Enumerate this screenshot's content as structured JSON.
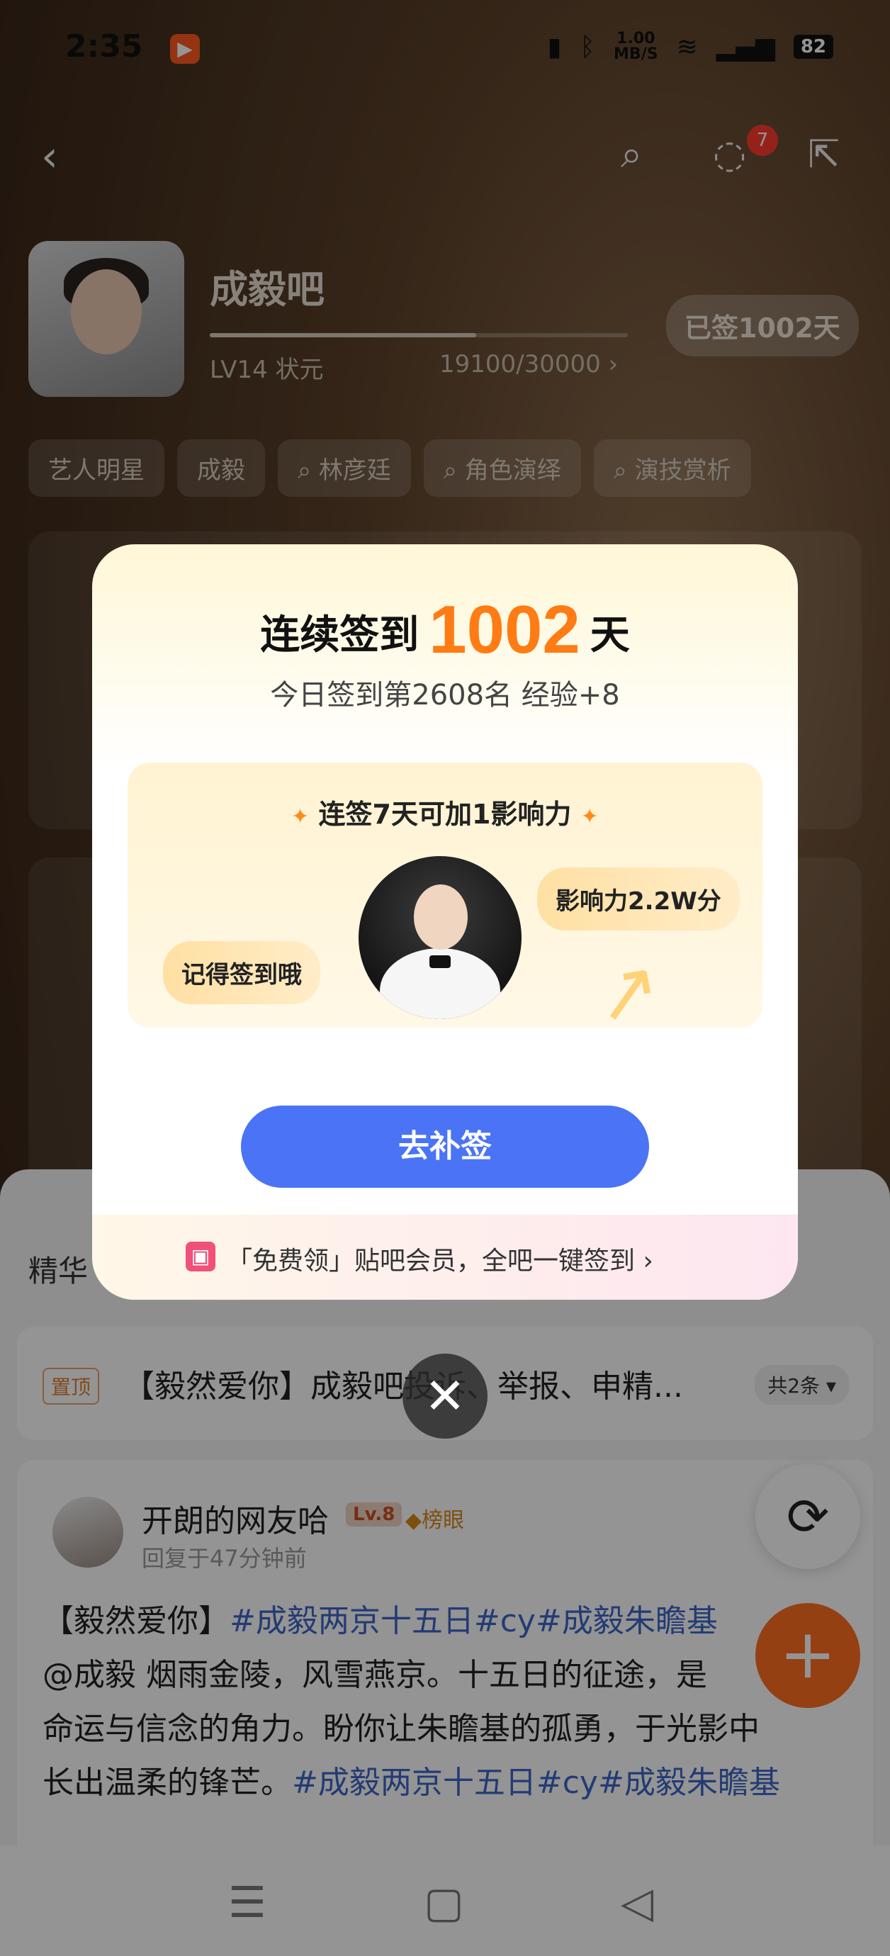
{
  "status_bar": {
    "time": "2:35",
    "speed_value": "1.00",
    "speed_unit": "MB/S",
    "battery": "82"
  },
  "header": {
    "message_badge": "7"
  },
  "forum": {
    "name": "成毅吧",
    "level": "LV14 状元",
    "exp": "19100/30000 ›",
    "exp_progress": 0.637,
    "signed_days": "已签1002天",
    "tags": [
      "艺人明星",
      "成毅",
      "林彦廷",
      "角色演绎",
      "演技赏析"
    ]
  },
  "feed": {
    "section_title": "精华",
    "pinned": {
      "tag": "置顶",
      "text": "【毅然爱你】成毅吧投诉、举报、申精...",
      "count": "共2条"
    },
    "post": {
      "user": "开朗的网友哈",
      "level_badge": "Lv.8",
      "rank_badge": "榜眼",
      "time": "回复于47分钟前",
      "line1_a": "【毅然爱你】",
      "line1_b": "#成毅两京十五日#cy#成毅朱瞻基",
      "line2": "@成毅 烟雨金陵，风雪燕京。十五日的征途，是",
      "line3": "命运与信念的角力。盼你让朱瞻基的孤勇，于光影中",
      "line4_a": "长出温柔的锋芒。",
      "line4_b": "#成毅两京十五日#cy#成毅朱瞻基"
    }
  },
  "modal": {
    "title_prefix": "连续签到",
    "streak_days": "1002",
    "title_suffix": "天",
    "subtitle": "今日签到第2608名 经验+8",
    "panel_title": "连签7天可加1影响力",
    "reminder_bubble": "记得签到哦",
    "influence_bubble": "影响力2.2W分",
    "cta_label": "去补签",
    "footer_text": "「免费领」贴吧会员，全吧一键签到 ›"
  },
  "colors": {
    "accent_orange": "#ff7b14",
    "cta_blue": "#4a74f5"
  }
}
